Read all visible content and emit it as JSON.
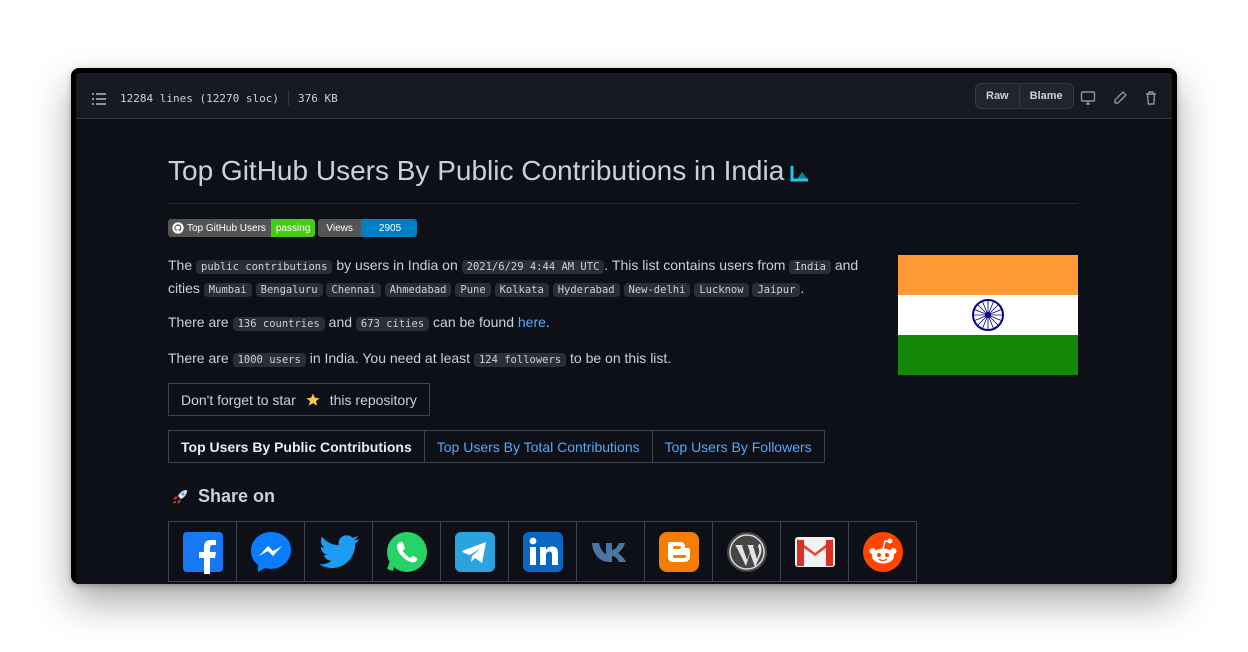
{
  "filebar": {
    "lines": "12284 lines (12270 sloc)",
    "size": "376 KB",
    "raw_label": "Raw",
    "blame_label": "Blame"
  },
  "readme": {
    "title": "Top GitHub Users By Public Contributions in India",
    "badges": {
      "build_left": "Top GitHub Users",
      "build_right": "passing",
      "views_left": "Views",
      "views_right": "2905"
    },
    "line1": {
      "t1": "The",
      "code1": "public contributions",
      "t2": "by users in India on",
      "code2": "2021/6/29 4:44 AM UTC",
      "t3": ". This list contains users from",
      "code3": "India",
      "t4": "and",
      "t5": "cities",
      "cities": [
        "Mumbai",
        "Bengaluru",
        "Chennai",
        "Ahmedabad",
        "Pune",
        "Kolkata",
        "Hyderabad",
        "New-delhi",
        "Lucknow",
        "Jaipur"
      ],
      "t6": "."
    },
    "line2": {
      "t1": "There are",
      "code1": "136 countries",
      "t2": "and",
      "code2": "673 cities",
      "t3": "can be found",
      "link": "here",
      "t4": "."
    },
    "line3": {
      "t1": "There are",
      "code1": "1000 users",
      "t2": "in India. You need at least",
      "code2": "124 followers",
      "t3": "to be on this list."
    },
    "star_prefix": "Don't forget to star",
    "star_suffix": "this repository",
    "tabs": [
      "Top Users By Public Contributions",
      "Top Users By Total Contributions",
      "Top Users By Followers"
    ],
    "share_title": "Share on",
    "share_icons": [
      "facebook-icon",
      "messenger-icon",
      "twitter-icon",
      "whatsapp-icon",
      "telegram-icon",
      "linkedin-icon",
      "vk-icon",
      "blogger-icon",
      "wordpress-icon",
      "gmail-icon",
      "reddit-icon"
    ]
  },
  "colors": {
    "background": "#0d1117",
    "link": "#58a6ff",
    "badge_passing": "#4c1",
    "badge_views": "#007ec6",
    "flag_saffron": "#ff9933",
    "flag_green": "#138808",
    "flag_chakra": "#000080"
  }
}
